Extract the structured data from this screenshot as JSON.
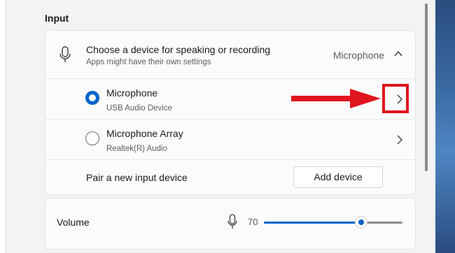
{
  "section": {
    "title": "Input"
  },
  "device_selector": {
    "title": "Choose a device for speaking or recording",
    "subtitle": "Apps might have their own settings",
    "current_value": "Microphone",
    "expanded": true
  },
  "devices": [
    {
      "name": "Microphone",
      "description": "USB Audio Device",
      "selected": true
    },
    {
      "name": "Microphone Array",
      "description": "Realtek(R) Audio",
      "selected": false
    }
  ],
  "pair": {
    "label": "Pair a new input device",
    "button_label": "Add device"
  },
  "volume": {
    "label": "Volume",
    "value": "70",
    "level": 0.7
  },
  "colors": {
    "accent": "#0064c8",
    "annotation": "#e0141e"
  },
  "icons": [
    "microphone-icon",
    "chevron-up-icon",
    "chevron-right-icon"
  ]
}
